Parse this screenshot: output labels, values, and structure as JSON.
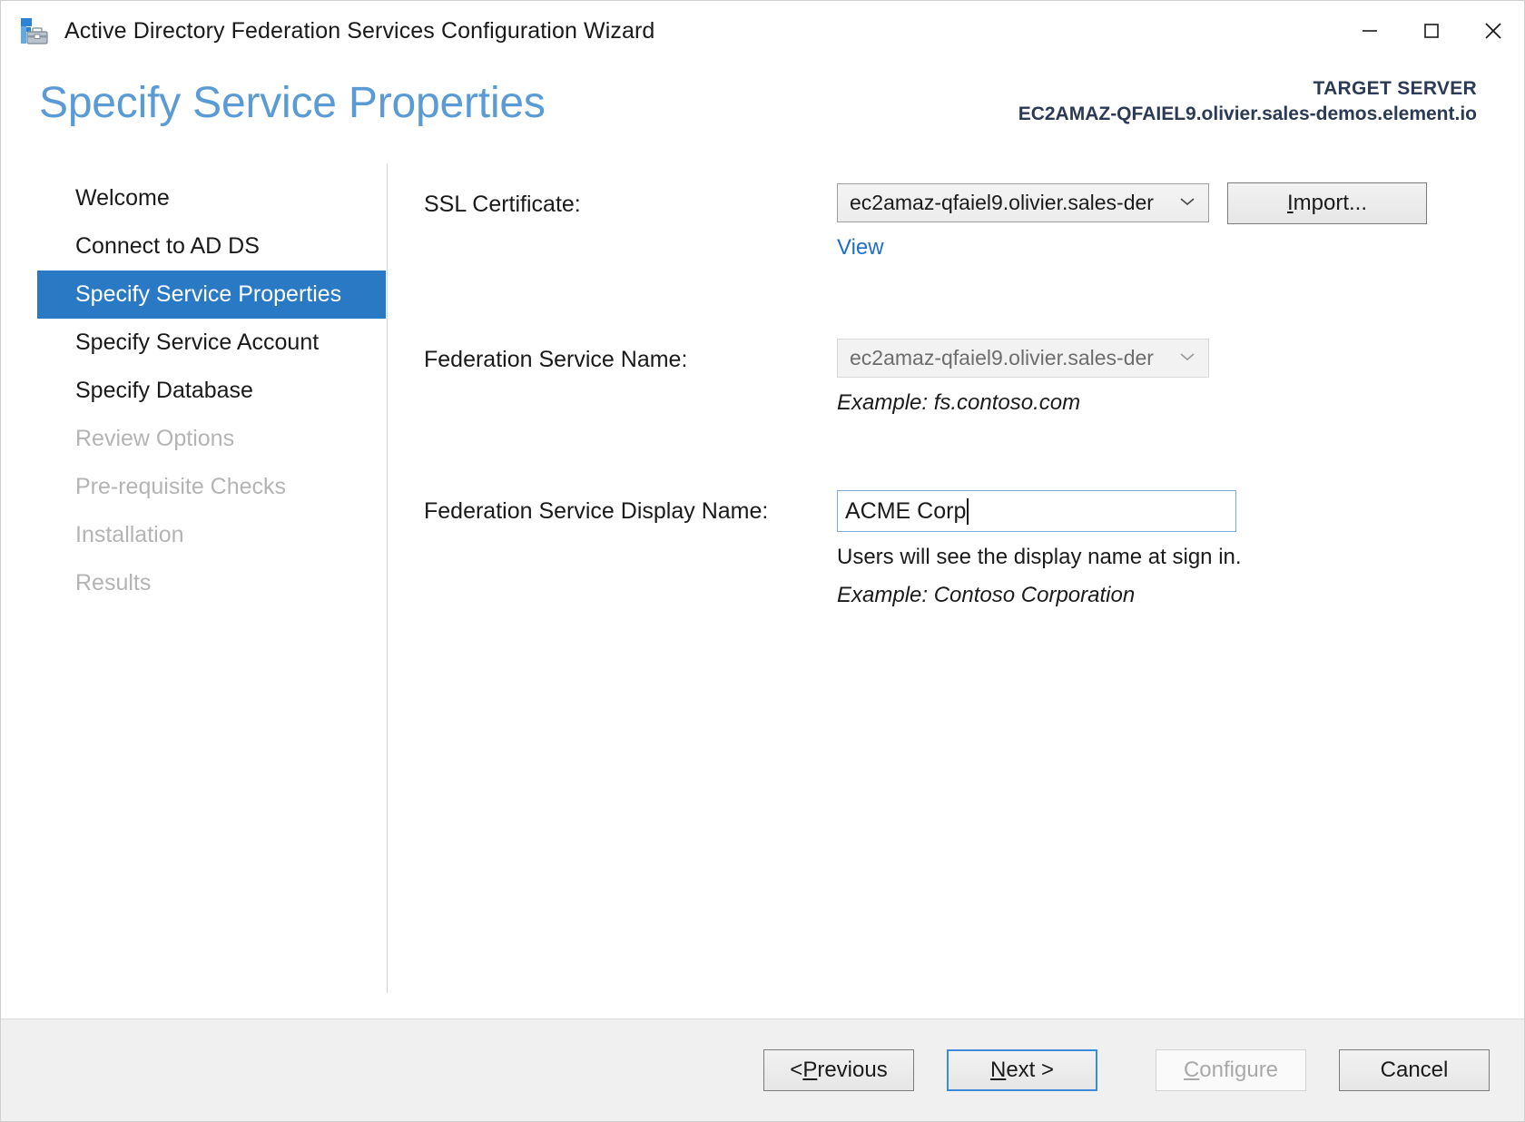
{
  "window": {
    "title": "Active Directory Federation Services Configuration Wizard",
    "icon": "adfs-wizard-icon",
    "controls": {
      "minimize": "minimize-icon",
      "maximize": "maximize-icon",
      "close": "close-icon"
    }
  },
  "header": {
    "page_title": "Specify Service Properties",
    "target_label": "TARGET SERVER",
    "target_server": "EC2AMAZ-QFAIEL9.olivier.sales-demos.element.io"
  },
  "sidebar": {
    "items": [
      {
        "label": "Welcome",
        "state": "enabled"
      },
      {
        "label": "Connect to AD DS",
        "state": "enabled"
      },
      {
        "label": "Specify Service Properties",
        "state": "selected"
      },
      {
        "label": "Specify Service Account",
        "state": "enabled"
      },
      {
        "label": "Specify Database",
        "state": "enabled"
      },
      {
        "label": "Review Options",
        "state": "disabled"
      },
      {
        "label": "Pre-requisite Checks",
        "state": "disabled"
      },
      {
        "label": "Installation",
        "state": "disabled"
      },
      {
        "label": "Results",
        "state": "disabled"
      }
    ]
  },
  "form": {
    "ssl_certificate": {
      "label": "SSL Certificate:",
      "value": "ec2amaz-qfaiel9.olivier.sales-der",
      "import_button": "Import...",
      "import_accel": "I",
      "import_rest": "mport...",
      "view_link": "View"
    },
    "federation_service_name": {
      "label": "Federation Service Name:",
      "value": "ec2amaz-qfaiel9.olivier.sales-der",
      "example": "Example: fs.contoso.com"
    },
    "federation_service_display_name": {
      "label": "Federation Service Display Name:",
      "value": "ACME Corp",
      "help": "Users will see the display name at sign in.",
      "example": "Example: Contoso Corporation"
    }
  },
  "footer": {
    "previous": {
      "accel": "P",
      "prefix": "< ",
      "rest": "revious"
    },
    "next": {
      "accel": "N",
      "prefix": "",
      "rest": "ext >"
    },
    "configure": {
      "accel": "C",
      "prefix": "",
      "rest": "onfigure"
    },
    "cancel": {
      "accel": "",
      "prefix": "",
      "rest": "Cancel"
    }
  },
  "colors": {
    "accent": "#2a79c4",
    "title_blue": "#5b9bd5",
    "link": "#1f6fc4",
    "target_text": "#2b3a55"
  }
}
